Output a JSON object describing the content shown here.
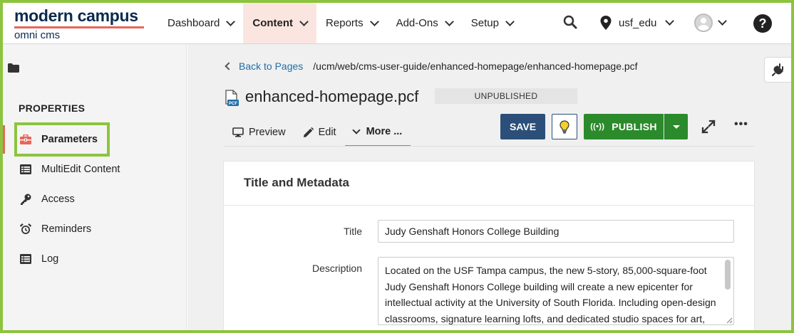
{
  "brand": {
    "line1": "modern campus",
    "line2": "omni cms",
    "accent": "#e8665a",
    "navy": "#0b2a4e"
  },
  "nav": {
    "items": [
      {
        "label": "Dashboard"
      },
      {
        "label": "Content"
      },
      {
        "label": "Reports"
      },
      {
        "label": "Add-Ons"
      },
      {
        "label": "Setup"
      }
    ],
    "active": "Content",
    "site": "usf_edu",
    "icons": [
      "search-icon",
      "location-pin-icon",
      "user-avatar-icon",
      "help-icon"
    ]
  },
  "sidebar": {
    "heading": "PROPERTIES",
    "items": [
      {
        "label": "Parameters",
        "icon": "toolbox-icon"
      },
      {
        "label": "MultiEdit Content",
        "icon": "list-icon"
      },
      {
        "label": "Access",
        "icon": "key-icon"
      },
      {
        "label": "Reminders",
        "icon": "alarm-clock-icon"
      },
      {
        "label": "Log",
        "icon": "list-icon"
      }
    ],
    "active": "Parameters"
  },
  "page": {
    "back_label": "Back to Pages",
    "path": "/ucm/web/cms-user-guide/enhanced-homepage/enhanced-homepage.pcf",
    "file_badge": "PCF",
    "filename": "enhanced-homepage.pcf",
    "status": "UNPUBLISHED"
  },
  "tabs": {
    "preview": "Preview",
    "edit": "Edit",
    "more": "More ..."
  },
  "actions": {
    "save": "SAVE",
    "publish": "PUBLISH",
    "save_color": "#2b4f79",
    "publish_color": "#2b8a2b"
  },
  "form": {
    "section_title": "Title and Metadata",
    "title_label": "Title",
    "title_value": "Judy Genshaft Honors College Building",
    "description_label": "Description",
    "description_value": "Located on the USF Tampa campus, the new 5-story, 85,000-square-foot Judy Genshaft Honors College building will create a new epicenter for intellectual activity at the University of South Florida. Including open-design classrooms, signature learning lofts, and dedicated studio spaces for art, music, and technology, the facility will support students in their pursuit of"
  }
}
